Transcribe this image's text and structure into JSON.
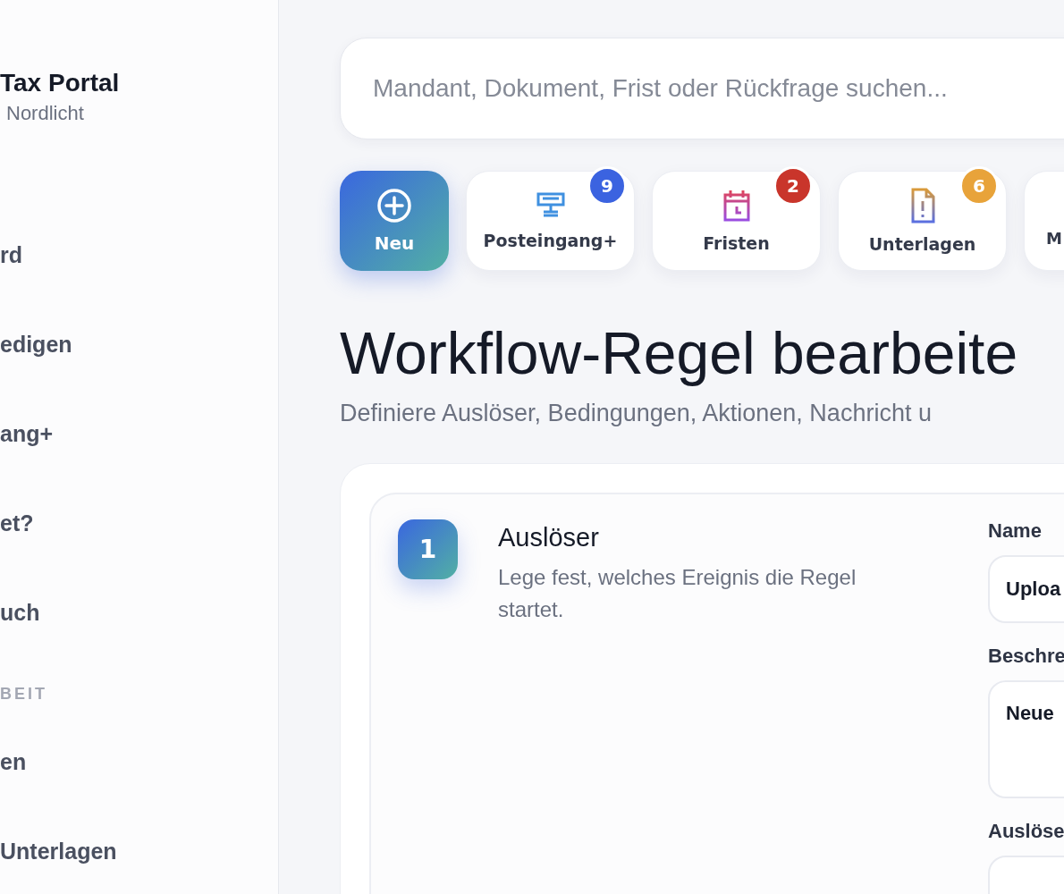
{
  "sidebar": {
    "brand": {
      "title": "Tax Portal",
      "subtitle": "Nordlicht"
    },
    "items": [
      {
        "label": "rd"
      },
      {
        "label": "edigen"
      },
      {
        "label": "ang+"
      },
      {
        "label": "et?"
      },
      {
        "label": "uch"
      }
    ],
    "section": {
      "label": "BEIT",
      "items": [
        {
          "label": "en"
        },
        {
          "label": "Unterlagen"
        }
      ]
    }
  },
  "search": {
    "placeholder": "Mandant, Dokument, Frist oder Rückfrage suchen..."
  },
  "quick_actions": [
    {
      "kind": "new",
      "label": "Neu"
    },
    {
      "kind": "inbox",
      "label": "Posteingang+",
      "badge": "9",
      "color": "#3b63e0"
    },
    {
      "kind": "deadlines",
      "label": "Fristen",
      "badge": "2",
      "color": "#c9352b"
    },
    {
      "kind": "documents",
      "label": "Unterlagen",
      "badge": "6",
      "color": "#e8a33a"
    },
    {
      "kind": "more",
      "label": "M"
    }
  ],
  "page": {
    "title": "Workflow-Regel bearbeite",
    "subtitle": "Definiere Auslöser, Bedingungen, Aktionen, Nachricht u"
  },
  "step": {
    "number": "1",
    "title": "Auslöser",
    "description": "Lege fest, welches Ereignis die Regel startet.",
    "fields": [
      {
        "kind": "input",
        "label": "Name",
        "value": "Uploa"
      },
      {
        "kind": "textarea",
        "label": "Beschre",
        "value": "Neue"
      },
      {
        "kind": "input",
        "label": "Auslöse"
      }
    ]
  }
}
